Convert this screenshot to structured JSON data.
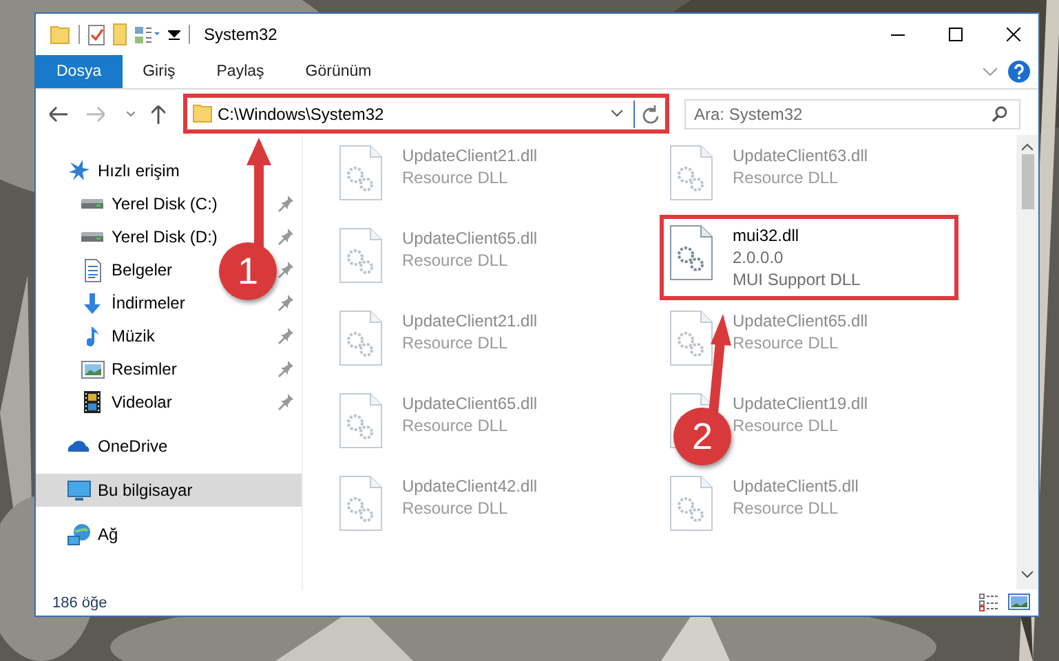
{
  "window": {
    "title": "System32"
  },
  "ribbon": {
    "tabs": [
      {
        "label": "Dosya",
        "selected": true
      },
      {
        "label": "Giriş",
        "selected": false
      },
      {
        "label": "Paylaş",
        "selected": false
      },
      {
        "label": "Görünüm",
        "selected": false
      }
    ]
  },
  "address_bar": {
    "path": "C:\\Windows\\System32",
    "highlighted": true
  },
  "search": {
    "placeholder": "Ara: System32"
  },
  "navigation": [
    {
      "label": "Hızlı erişim",
      "kind": "star",
      "selected": false,
      "children": [
        {
          "label": "Yerel Disk (C:)",
          "kind": "drive",
          "pinned": true
        },
        {
          "label": "Yerel Disk (D:)",
          "kind": "drive",
          "pinned": true
        },
        {
          "label": "Belgeler",
          "kind": "document",
          "pinned": true
        },
        {
          "label": "İndirmeler",
          "kind": "download",
          "pinned": true
        },
        {
          "label": "Müzik",
          "kind": "music",
          "pinned": true
        },
        {
          "label": "Resimler",
          "pinned": true
        },
        {
          "label": "Videolar",
          "kind": "film",
          "pinned": true
        }
      ]
    },
    {
      "label": "OneDrive",
      "kind": "cloud",
      "selected": false
    },
    {
      "label": "Bu bilgisayar",
      "kind": "computer",
      "selected": true
    },
    {
      "label": "Ağ",
      "kind": "network",
      "selected": false
    }
  ],
  "files": [
    {
      "name": "UpdateClient21.dll",
      "details": [
        "Resource DLL"
      ],
      "blurred": true,
      "highlighted": false
    },
    {
      "name": "UpdateClient63.dll",
      "details": [
        "Resource DLL"
      ],
      "blurred": true,
      "highlighted": false
    },
    {
      "name": "UpdateClient65.dll",
      "details": [
        "Resource DLL"
      ],
      "blurred": true,
      "highlighted": false
    },
    {
      "name": "mui32.dll",
      "details": [
        "2.0.0.0",
        "MUI Support DLL"
      ],
      "blurred": false,
      "highlighted": true
    },
    {
      "name": "UpdateClient21.dll",
      "details": [
        "Resource DLL"
      ],
      "blurred": true,
      "highlighted": false
    },
    {
      "name": "UpdateClient65.dll",
      "details": [
        "Resource DLL"
      ],
      "blurred": true,
      "highlighted": false
    },
    {
      "name": "UpdateClient65.dll",
      "details": [
        "Resource DLL"
      ],
      "blurred": true,
      "highlighted": false
    },
    {
      "name": "UpdateClient19.dll",
      "details": [
        "Resource DLL"
      ],
      "blurred": true,
      "highlighted": false
    },
    {
      "name": "UpdateClient42.dll",
      "details": [
        "Resource DLL"
      ],
      "blurred": true,
      "highlighted": false
    },
    {
      "name": "UpdateClient5.dll",
      "details": [
        "Resource DLL"
      ],
      "blurred": true,
      "highlighted": false
    }
  ],
  "status_bar": {
    "item_count": "186 öğe"
  },
  "annotations": [
    {
      "label": "1"
    },
    {
      "label": "2"
    }
  ]
}
